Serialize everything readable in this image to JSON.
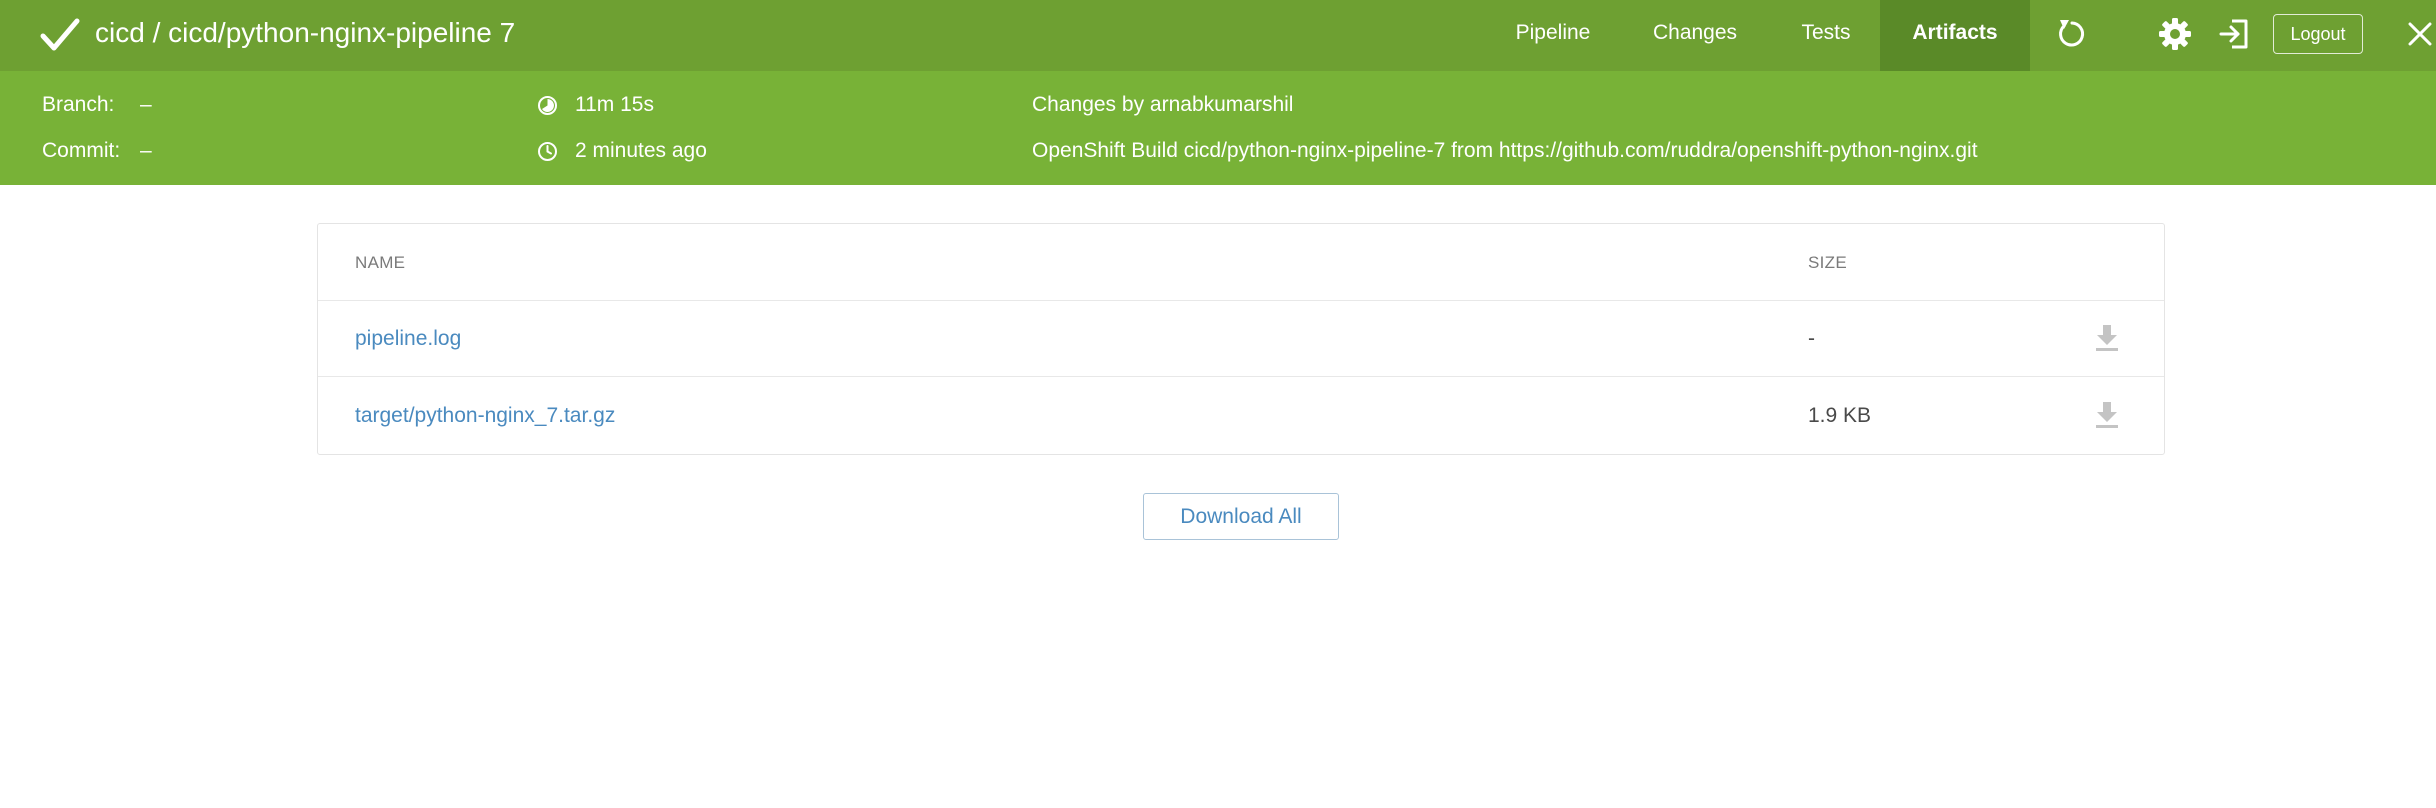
{
  "header": {
    "status_icon": "checkmark-icon",
    "title": "cicd / cicd/python-nginx-pipeline 7",
    "tabs": [
      {
        "label": "Pipeline",
        "active": false
      },
      {
        "label": "Changes",
        "active": false
      },
      {
        "label": "Tests",
        "active": false
      },
      {
        "label": "Artifacts",
        "active": true
      }
    ],
    "icons": [
      "replay-icon",
      "gear-icon",
      "sign-out-icon",
      "close-icon"
    ],
    "logout_label": "Logout"
  },
  "info": {
    "branch_label": "Branch:",
    "branch_value": "–",
    "commit_label": "Commit:",
    "commit_value": "–",
    "duration": "11m 15s",
    "time_ago": "2 minutes ago",
    "changes_text": "Changes by arnabkumarshil",
    "cause_text": "OpenShift Build cicd/python-nginx-pipeline-7 from https://github.com/ruddra/openshift-python-nginx.git"
  },
  "artifacts": {
    "columns": {
      "name": "NAME",
      "size": "SIZE"
    },
    "rows": [
      {
        "name": "pipeline.log",
        "size": "-"
      },
      {
        "name": "target/python-nginx_7.tar.gz",
        "size": "1.9 KB"
      }
    ],
    "download_all_label": "Download All"
  },
  "colors": {
    "topbar": "#6ea032",
    "infobar": "#78b237",
    "active_tab": "#5a8a28",
    "link": "#4a8abf"
  }
}
